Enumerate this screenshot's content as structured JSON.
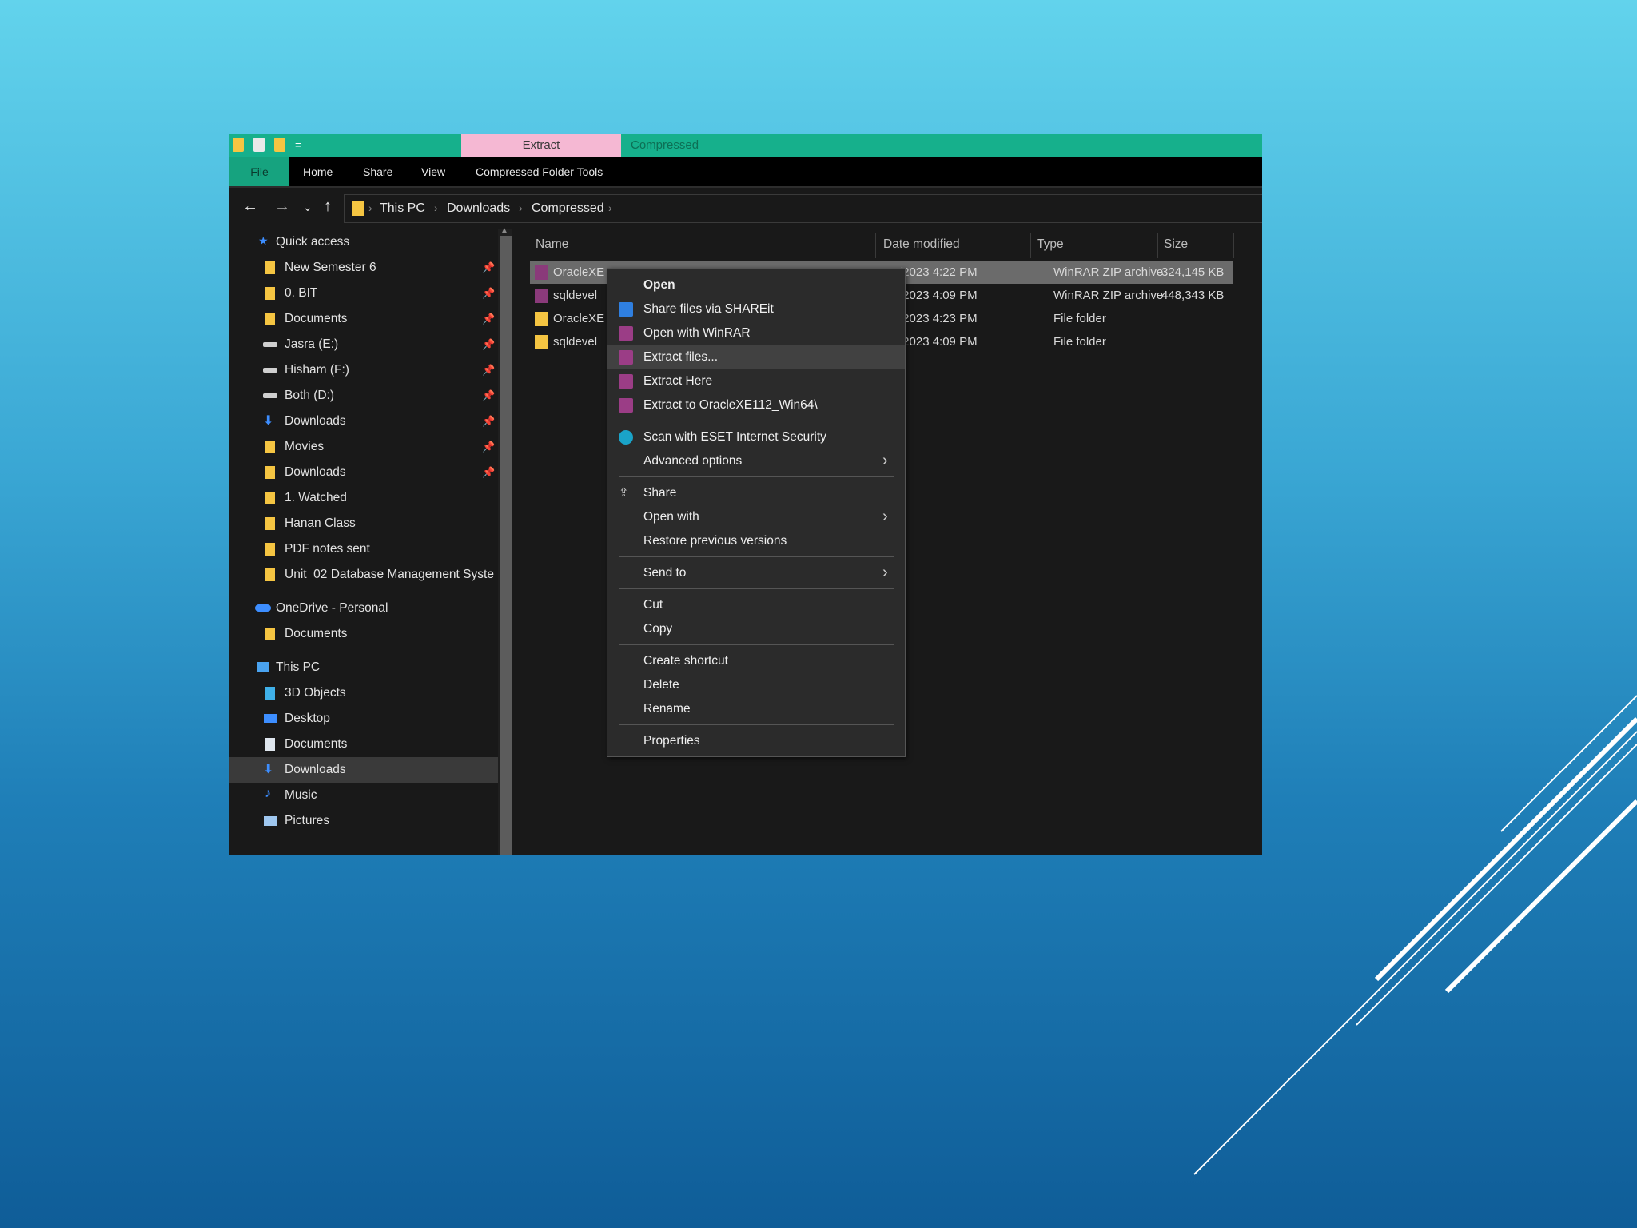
{
  "ribbon": {
    "context_tab_extract": "Extract",
    "context_tab_compressed": "Compressed",
    "tabs": [
      "File",
      "Home",
      "Share",
      "View",
      "Compressed Folder Tools"
    ]
  },
  "breadcrumb": [
    "This PC",
    "Downloads",
    "Compressed"
  ],
  "sidebar": {
    "quick_access": "Quick access",
    "quick_items": [
      {
        "label": "New Semester 6",
        "icon": "folder-icon"
      },
      {
        "label": "0. BIT",
        "icon": "folder-icon"
      },
      {
        "label": "Documents",
        "icon": "folder-icon"
      },
      {
        "label": "Jasra (E:)",
        "icon": "drive-icon"
      },
      {
        "label": "Hisham (F:)",
        "icon": "drive-icon"
      },
      {
        "label": "Both (D:)",
        "icon": "drive-icon"
      },
      {
        "label": "Downloads",
        "icon": "download-icon"
      },
      {
        "label": "Movies",
        "icon": "folder-icon"
      },
      {
        "label": "Downloads",
        "icon": "folder-icon"
      },
      {
        "label": "1. Watched",
        "icon": "folder-icon"
      },
      {
        "label": "Hanan Class",
        "icon": "folder-icon"
      },
      {
        "label": "PDF notes sent",
        "icon": "folder-icon"
      },
      {
        "label": "Unit_02 Database Management Syste",
        "icon": "folder-icon"
      }
    ],
    "onedrive": "OneDrive - Personal",
    "onedrive_items": [
      {
        "label": "Documents"
      }
    ],
    "this_pc": "This PC",
    "pc_items": [
      {
        "label": "3D Objects"
      },
      {
        "label": "Desktop"
      },
      {
        "label": "Documents"
      },
      {
        "label": "Downloads"
      },
      {
        "label": "Music"
      },
      {
        "label": "Pictures"
      }
    ]
  },
  "columns": {
    "name": "Name",
    "date": "Date modified",
    "type": "Type",
    "size": "Size"
  },
  "files": [
    {
      "name": "OracleXE",
      "date": "/2023 4:22 PM",
      "type": "WinRAR ZIP archive",
      "size": "324,145 KB"
    },
    {
      "name": "sqldevel",
      "date": "/2023 4:09 PM",
      "type": "WinRAR ZIP archive",
      "size": "448,343 KB"
    },
    {
      "name": "OracleXE",
      "date": "/2023 4:23 PM",
      "type": "File folder",
      "size": ""
    },
    {
      "name": "sqldevel",
      "date": "/2023 4:09 PM",
      "type": "File folder",
      "size": ""
    }
  ],
  "context_menu": {
    "group1": [
      "Open",
      "Share files via SHAREit",
      "Open with WinRAR",
      "Extract files...",
      "Extract Here",
      "Extract to OracleXE112_Win64\\"
    ],
    "group2": [
      "Scan with ESET Internet Security",
      "Advanced options"
    ],
    "group3": [
      "Share",
      "Open with",
      "Restore previous versions"
    ],
    "group4": [
      "Send to"
    ],
    "group5": [
      "Cut",
      "Copy"
    ],
    "group6": [
      "Create shortcut",
      "Delete",
      "Rename"
    ],
    "group7": [
      "Properties"
    ]
  },
  "colors": {
    "accent_green": "#16b08c",
    "extract_tab_pink": "#f5b8d3",
    "folder_yellow": "#f5c542",
    "dark_bg": "#191919"
  }
}
